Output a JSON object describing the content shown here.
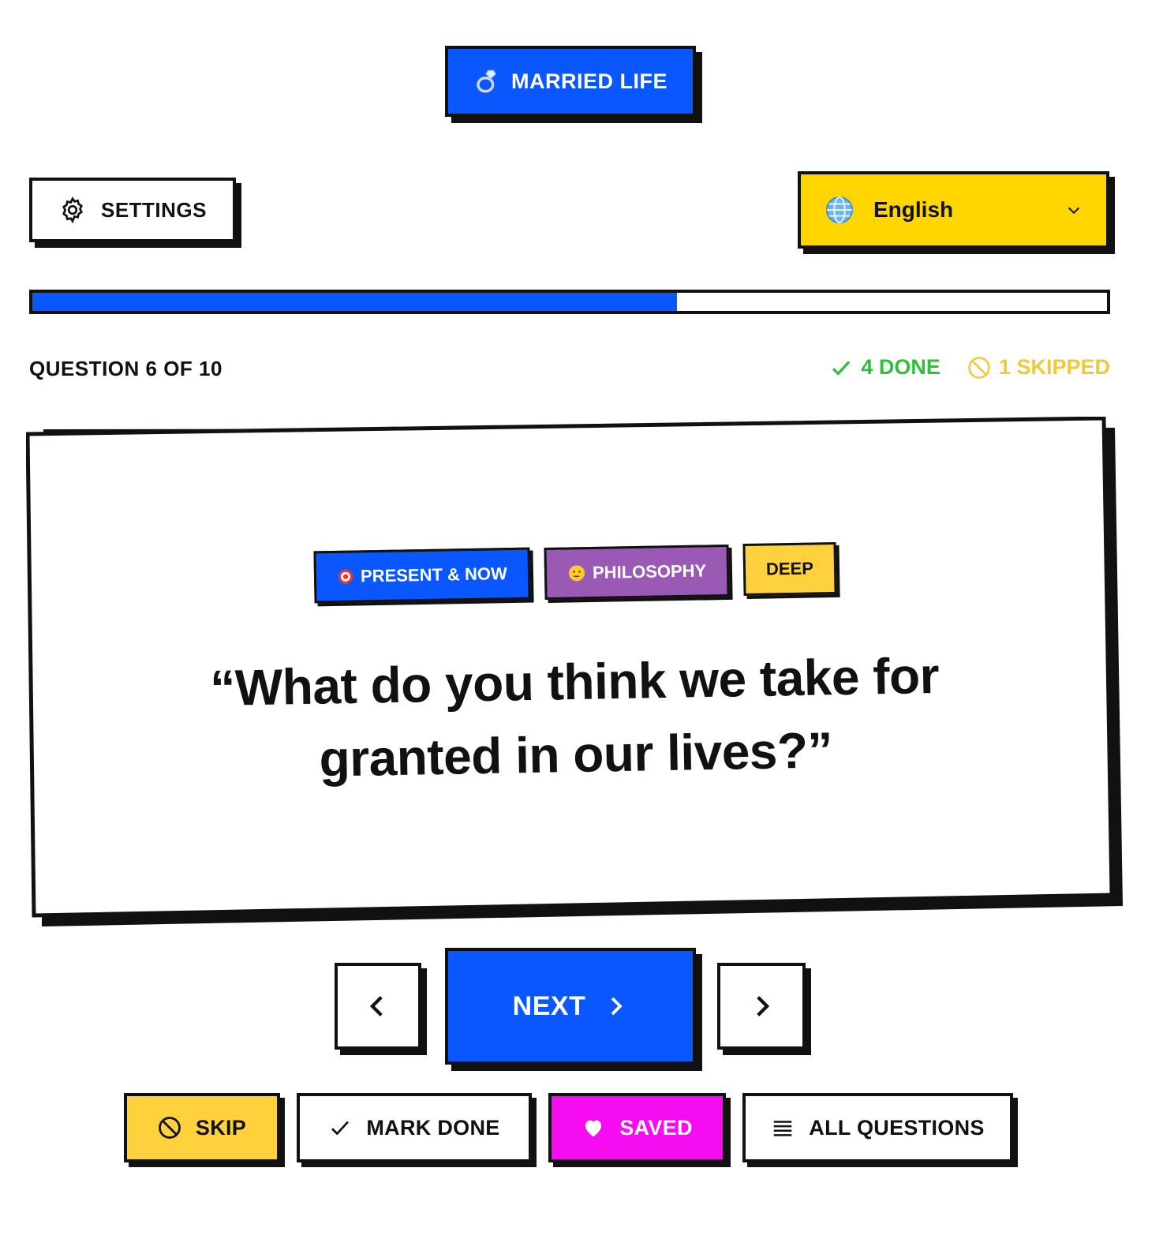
{
  "category": {
    "label": "MARRIED LIFE",
    "icon": "ring-icon"
  },
  "settings": {
    "label": "SETTINGS",
    "icon": "gear-icon"
  },
  "language": {
    "selected": "English",
    "icon": "globe-icon"
  },
  "progress": {
    "fraction": 0.6
  },
  "counter": {
    "text": "QUESTION 6 OF 10"
  },
  "stats": {
    "done_text": "4 DONE",
    "skipped_text": "1 SKIPPED",
    "done_color": "#2fbf3a",
    "skipped_color": "#f0c93a"
  },
  "card": {
    "tags": [
      {
        "label": "PRESENT & NOW",
        "icon": "target-icon",
        "color": "#0a57ff"
      },
      {
        "label": "PHILOSOPHY",
        "icon": "thinking-face-icon",
        "color": "#9b59b6"
      },
      {
        "label": "DEEP",
        "color": "#ffd23d"
      }
    ],
    "question": "“What do you think we take for granted in our lives?”"
  },
  "nav": {
    "next_label": "NEXT"
  },
  "actions": {
    "skip_label": "SKIP",
    "mark_done_label": "MARK DONE",
    "saved_label": "SAVED",
    "all_questions_label": "ALL QUESTIONS"
  },
  "colors": {
    "accent_blue": "#0a57ff",
    "yellow": "#ffd600",
    "magenta": "#f60cf0",
    "purple": "#9b59b6"
  }
}
